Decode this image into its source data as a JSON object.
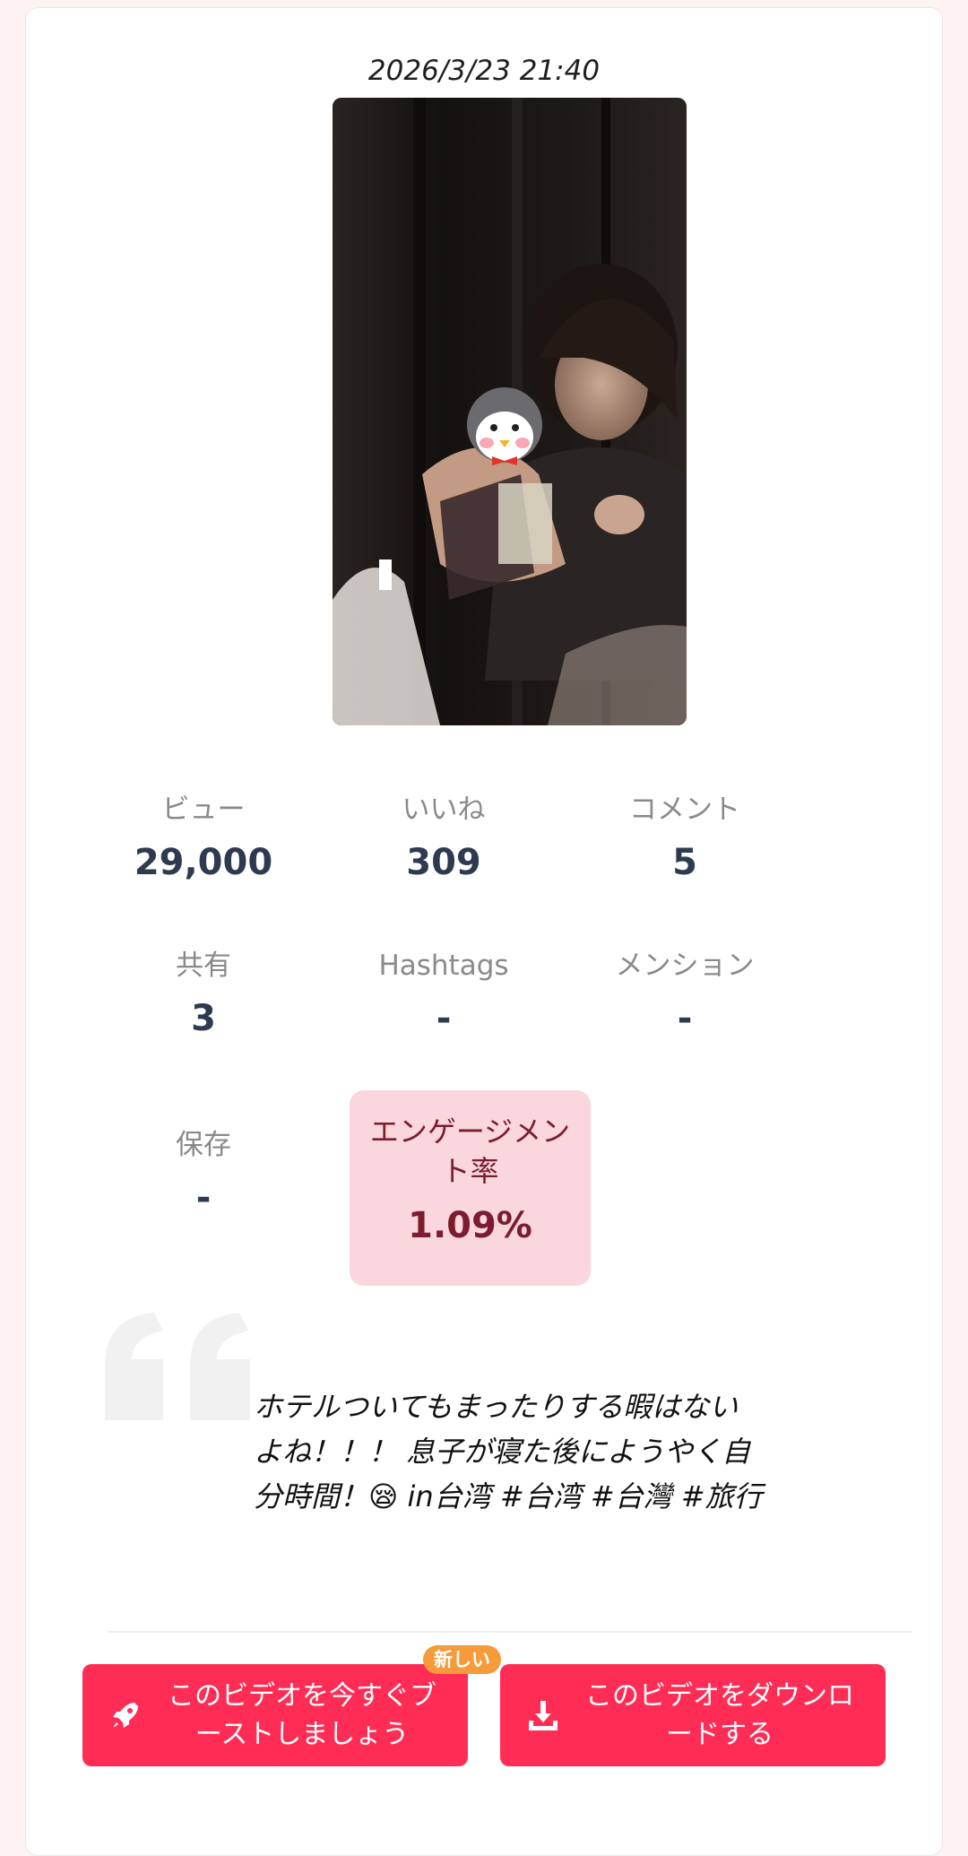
{
  "post": {
    "timestamp": "2026/3/23 21:40",
    "caption": "ホテルついてもまったりする暇はないよね！！！ 息子が寝た後にようやく自分時間！😪 in台湾 #台湾 #台灣 #旅行"
  },
  "stats": {
    "views": {
      "label": "ビュー",
      "value": "29,000"
    },
    "likes": {
      "label": "いいね",
      "value": "309"
    },
    "comments": {
      "label": "コメント",
      "value": "5"
    },
    "shares": {
      "label": "共有",
      "value": "3"
    },
    "hashtags": {
      "label": "Hashtags",
      "value": "-"
    },
    "mentions": {
      "label": "メンション",
      "value": "-"
    },
    "saves": {
      "label": "保存",
      "value": "-"
    },
    "engagement": {
      "label": "エンゲージメント率",
      "value": "1.09%"
    }
  },
  "actions": {
    "boost_label": "このビデオを今すぐブーストしましょう",
    "boost_badge": "新しい",
    "download_label": "このビデオをダウンロードする"
  },
  "icons": {
    "boost": "rocket-icon",
    "download": "download-icon",
    "quote": "quote-icon"
  },
  "colors": {
    "accent": "#ff2d55",
    "badge": "#f59b3a",
    "engagement_bg": "#f9d7dc",
    "engagement_text": "#7b1d2e"
  }
}
